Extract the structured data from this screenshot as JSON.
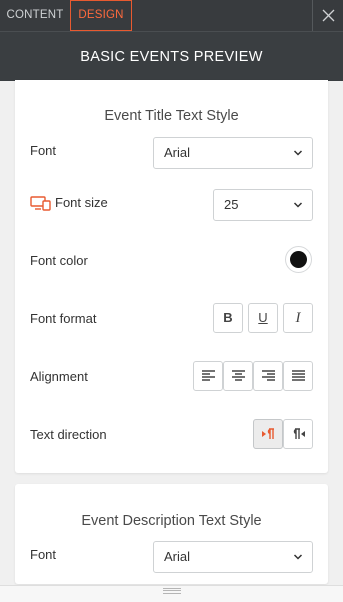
{
  "tabs": {
    "content": "CONTENT",
    "design": "DESIGN"
  },
  "header": {
    "title": "BASIC EVENTS PREVIEW"
  },
  "title_section": {
    "heading": "Event Title Text Style",
    "font": {
      "label": "Font",
      "value": "Arial"
    },
    "font_size": {
      "label": "Font size",
      "value": "25"
    },
    "font_color": {
      "label": "Font color",
      "color": "#111111"
    },
    "font_format": {
      "label": "Font format",
      "bold": "B",
      "underline": "U",
      "italic": "I"
    },
    "alignment": {
      "label": "Alignment",
      "options": [
        "align-left",
        "align-center",
        "align-right",
        "align-justify"
      ]
    },
    "text_direction": {
      "label": "Text direction",
      "active": "rtl"
    }
  },
  "description_section": {
    "heading": "Event Description Text Style",
    "font": {
      "label": "Font",
      "value": "Arial"
    }
  },
  "colors": {
    "accent": "#e85a30",
    "dark": "#383b3e"
  }
}
